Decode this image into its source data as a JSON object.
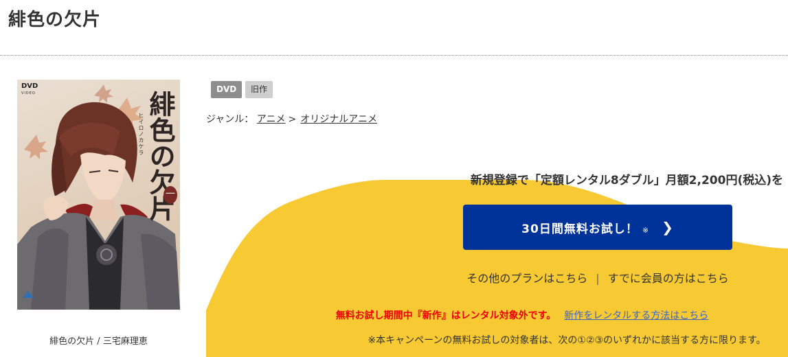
{
  "page": {
    "title": "緋色の欠片"
  },
  "product": {
    "cover_logo": "DVD",
    "cover_logo_sub": "VIDEO",
    "cover_title": "緋色の欠片",
    "cover_kana": "ヒイロノカケラ",
    "cover_volume": "一",
    "caption": "緋色の欠片 / 三宅麻理恵"
  },
  "tags": {
    "format": "DVD",
    "age": "旧作"
  },
  "genre": {
    "label": "ジャンル：",
    "level1": "アニメ",
    "separator": ">",
    "level2": "オリジナルアニメ"
  },
  "promo": {
    "headline": "新規登録で「定額レンタル8ダブル」月額2,200円(税込)を",
    "cta_label": "30日間無料お試し！",
    "cta_mark": "※",
    "other_plans": "その他のプランはこちら",
    "members": "すでに会員の方はこちら",
    "notice_red": "無料お試し期間中『新作』はレンタル対象外です。",
    "notice_link": "新作をレンタルする方法はこちら",
    "footnote": "※本キャンペーンの無料お試しの対象者は、次の①②③のいずれかに該当する方に限ります。"
  },
  "colors": {
    "promo_yellow": "#f7c933",
    "cta_blue": "#003399",
    "notice_red": "#ee0000",
    "link_blue": "#3a64c9",
    "tag_dvd": "#8d8d8d",
    "tag_old": "#cfcfcf"
  }
}
